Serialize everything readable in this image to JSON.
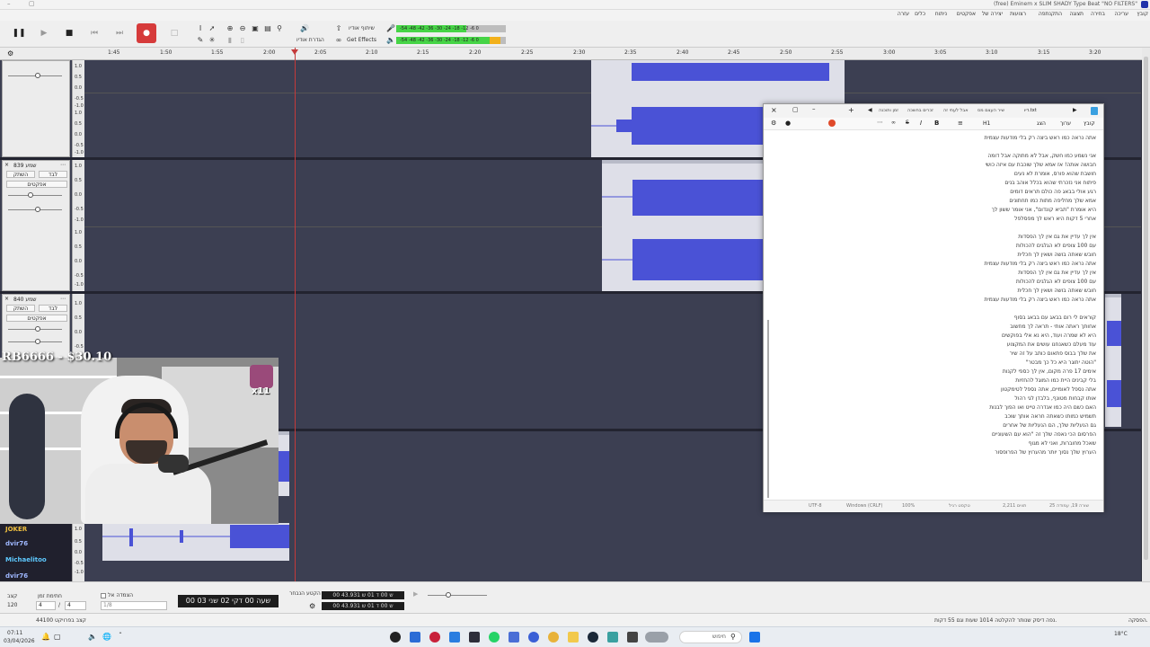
{
  "window": {
    "title": "(free) Eminem x SLIM SHADY Type Beat \"NO FILTERS\""
  },
  "menu": [
    "קובץ",
    "עריכה",
    "בחירה",
    "תצוגה",
    "התקנתפה",
    "רצועות",
    "יצירה של",
    "אפקטים",
    "ניתוח",
    "כלים",
    "עזרה"
  ],
  "toolbar": {
    "share_audio": "שיתוף אודיו",
    "get_effects": "Get Effects",
    "audio_setup": "הגדרת אודיו",
    "meter_scale": "-54 -48 -42 -36 -30 -24 -18 -12 -6 0"
  },
  "timeline": {
    "ticks": [
      "1:45",
      "1:50",
      "1:55",
      "2:00",
      "2:05",
      "2:10",
      "2:15",
      "2:20",
      "2:25",
      "2:30",
      "2:35",
      "2:40",
      "2:45",
      "2:50",
      "2:55",
      "3:00",
      "3:05",
      "3:10",
      "3:15",
      "3:20"
    ]
  },
  "tracks": [
    {
      "name": "",
      "mute": "השתק",
      "solo": "לבד",
      "effects": "אפקטים"
    },
    {
      "name": "שמע 839",
      "mute": "השתק",
      "solo": "לבד",
      "effects": "אפקטים"
    },
    {
      "name": "שמע 840",
      "mute": "השתק",
      "solo": "לבד",
      "effects": "אפקטים"
    }
  ],
  "ruler_labels": [
    "1.0",
    "0.5",
    "0.0",
    "-0.5",
    "-1.0"
  ],
  "overlay": {
    "donation": "RB6666 - $30.10",
    "multiplier": "x11"
  },
  "chat": {
    "users": [
      "JOKER",
      "dvir76",
      "Michaelitoo",
      "dvir76"
    ]
  },
  "selection": {
    "rate_label": "קצב",
    "rate_value": "120",
    "time_signature_label": "חתימת זמן",
    "ts_num": "4",
    "ts_den": "4",
    "snap_label": "הצמדה אל",
    "snap_value": "1/8",
    "big_time": "00 שעה 00 דקי 02 שני 03",
    "selection_label": "הקטע הנבחר",
    "start_time": "00 ש 00 ד 01 ש 43.931",
    "end_time": "00 ש 00 ד 01 ש 43.931"
  },
  "status": {
    "left": "קצב בפרויקט 44100",
    "right": "נפה דיסק שנותר להקלטה 1014 שעות וגם 55 דקות.",
    "state": "הפסקה."
  },
  "notepad": {
    "title": "דיו.txt",
    "tabs": [
      "שיר העצם מס",
      "אבל לעתי זה",
      "זכרים בחשכה",
      "זמן ותוכנה"
    ],
    "menu": [
      "קובץ",
      "ערוך",
      "הצג"
    ],
    "heading": "H1",
    "lines": [
      "אתה נראה כמו ראש ביצה רק בלי מודעות עצמית",
      "",
      "אני נשמע כמו חשק, אבל לא מתוקה אבל דומה",
      "חבושה אותה! אז אמא שלך שוכבת עם איזה כושי",
      "חושבת שהוא פורס, אומרת לא נעים",
      "פיתוח אני נזכרתי שהוא בכלל אוהב בנים",
      "רגע אולי בבאג פה כולם תראים דומים",
      "אמא שלך מחליפה מתות כמו תחתונים",
      "היא אומרת \"תביא קונדום\", אני אומר ששון לך",
      "אחרי 5 דקות היא ראש לך מפסלפל",
      "",
      "אין לך עדיין את גם אין לך הפסדות",
      "עם 100 צופים לא הגלגים להכולות",
      "חובש שאתה בושה ושאין לך חכלית",
      "אתה נראה כמו ראש ביצה רק בלי מודעות עצמית",
      "אין לך עדיין את גם אין לך הפסדות",
      "עם 100 צופים לא הגלגים להכולות",
      "חובש שאתה בושה ושאין לך חכלית",
      "אתה נראה כמו ראש ביצה רק בלי מודעות עצמית",
      "",
      "קוראים לי רום בבאג עם בבאג בסוף",
      "אחותך ראתה אותי - תראה לך מחשוב",
      "היא לא שמרה ועוד, היא נא אלי בפוקשים",
      "עוד מעלם כשאנחנו עושים את המקצוע",
      "את שלך בבוס פתאום כותב על זה שיר",
      "\"הוטה יתוגר היא כל כך מבטר\"",
      "אימים 17 פרה מקום, אין לך כספי לקנות",
      "בלי קבינים היית כמו המוגל להחזיות",
      "אתה נספל לאומיים, אתה נספל לטימקטון",
      "אותו קבחות מטונף, בלבדן לגי רהול",
      "האם כשם היה כמו אנדרה טייט ואו הפוך לבנות",
      "תשמיש כמותו כשאתה חראה אותך שוכב",
      "גם הנעליות שלך, הם הנעליות של אחרים",
      "הפרסום הכי נאפה שלך זה \"הוא עם השעוניים",
      "שאכל מחוברות, ואני לא מגוף",
      "הערוץ שלך נסוך יותר מהערוץ של הפרופסור"
    ],
    "status": {
      "pos": "שורה 19, עמודה 25",
      "chars": "2,211 תווים",
      "type": "טקסט רגיל",
      "zoom": "100%",
      "eol": "Windows (CRLF)",
      "enc": "UTF-8"
    }
  },
  "taskbar": {
    "time": "07:11",
    "date": "03/04/2026",
    "search": "חיפוש",
    "weather": "18°C"
  },
  "colors": {
    "waveform": "#4a52d6",
    "playhead": "#c43a3a",
    "record": "#d63b3b",
    "meter_green": "#46d446"
  }
}
